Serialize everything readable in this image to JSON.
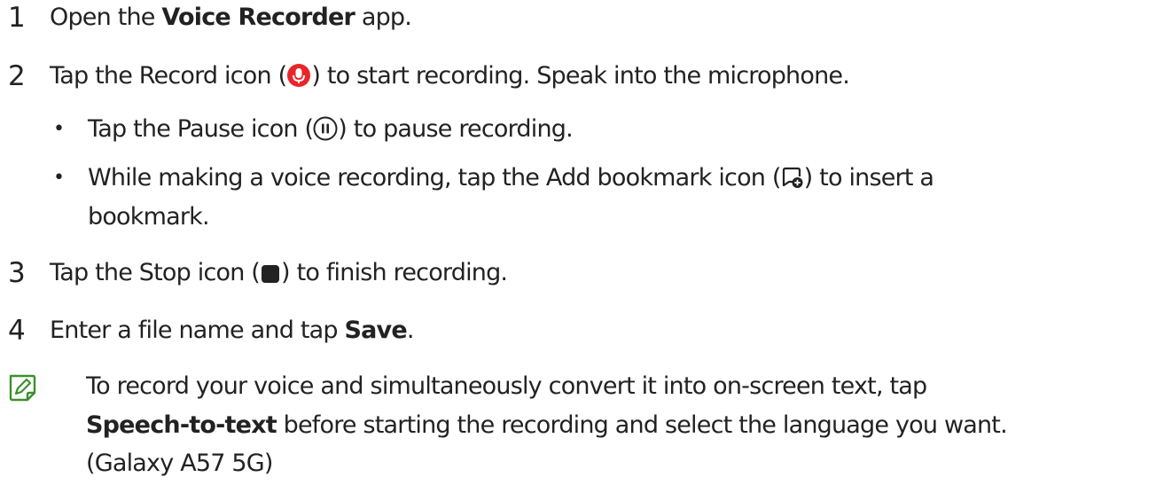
{
  "steps": [
    {
      "number": "1",
      "pre": "Open the ",
      "bold": "Voice Recorder",
      "post": " app."
    },
    {
      "number": "2",
      "pre": "Tap the Record icon (",
      "post": ") to start recording. Speak into the microphone."
    },
    {
      "number": "3",
      "pre": "Tap the Stop icon (",
      "post": ") to finish recording."
    },
    {
      "number": "4",
      "pre": "Enter a file name and tap ",
      "bold": "Save",
      "post": "."
    }
  ],
  "bullets": [
    {
      "bullet": "•",
      "pre": "Tap the Pause icon (",
      "post": ") to pause recording."
    },
    {
      "bullet": "•",
      "pre": "While making a voice recording, tap the Add bookmark icon (",
      "post": ") to insert a",
      "line2": "bookmark."
    }
  ],
  "note": {
    "line1": "To record your voice and simultaneously convert it into on-screen text, tap",
    "line2_bold": "Speech-to-text",
    "line2_rest": " before starting the recording and select the language you want.",
    "line3": "(Galaxy A57 5G)"
  },
  "icons": {
    "record": "microphone-record-icon",
    "pause": "pause-icon",
    "bookmark": "add-bookmark-icon",
    "stop": "stop-icon",
    "note": "note-pencil-icon"
  },
  "colors": {
    "text": "#222222",
    "record_red": "#e8262a",
    "note_green": "#3e8f2e"
  }
}
